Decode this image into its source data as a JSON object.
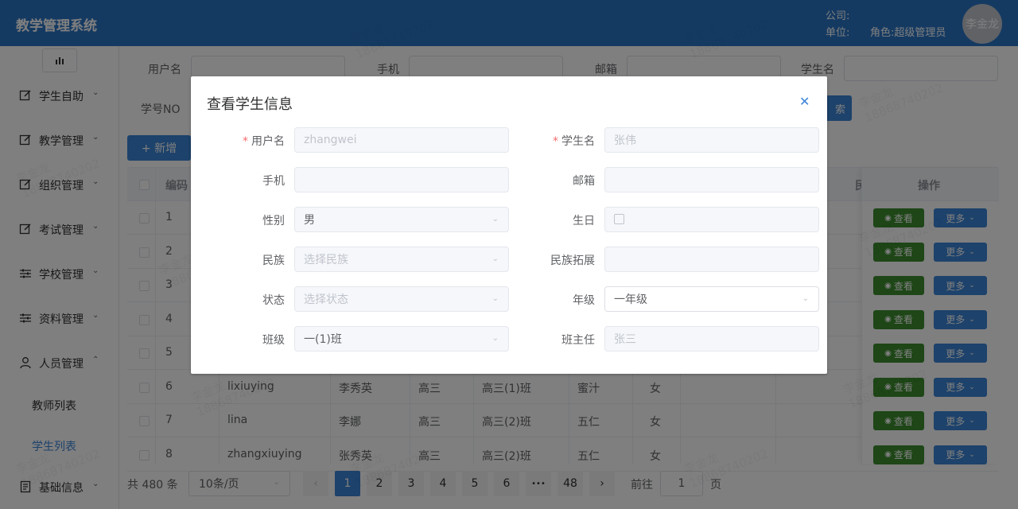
{
  "header": {
    "brand": "教学管理系统",
    "company_label": "公司:",
    "unit_label": "单位:",
    "role_label": "角色:超级管理员",
    "avatar_text": "李金龙"
  },
  "sidebar": {
    "items": [
      {
        "label": "学生自助",
        "icon": "edit-icon"
      },
      {
        "label": "教学管理",
        "icon": "edit-icon"
      },
      {
        "label": "组织管理",
        "icon": "edit-icon"
      },
      {
        "label": "考试管理",
        "icon": "edit-icon"
      },
      {
        "label": "学校管理",
        "icon": "sliders-icon"
      },
      {
        "label": "资料管理",
        "icon": "sliders-icon"
      },
      {
        "label": "人员管理",
        "icon": "user-icon"
      },
      {
        "label": "基础信息",
        "icon": "document-icon"
      }
    ],
    "subitems": [
      "教师列表",
      "学生列表"
    ]
  },
  "search": {
    "username_label": "用户名",
    "phone_label": "手机",
    "email_label": "邮箱",
    "student_name_label": "学生名",
    "student_no_label": "学号NO",
    "search_button": "索",
    "new_button": "+ 新增"
  },
  "table": {
    "headers": {
      "id": "编码",
      "ops": "操作",
      "partial": "民"
    },
    "rows": [
      {
        "id": "1"
      },
      {
        "id": "2"
      },
      {
        "id": "3"
      },
      {
        "id": "4"
      },
      {
        "id": "5"
      },
      {
        "id": "6",
        "username": "lixiuying",
        "name": "李秀英",
        "grade": "高三",
        "class": "高三(1)班",
        "ethnic": "蜜汁",
        "gender": "女"
      },
      {
        "id": "7",
        "username": "lina",
        "name": "李娜",
        "grade": "高三",
        "class": "高三(2)班",
        "ethnic": "五仁",
        "gender": "女"
      },
      {
        "id": "8",
        "username": "zhangxiuying",
        "name": "张秀英",
        "grade": "高三",
        "class": "高三(2)班",
        "ethnic": "五仁",
        "gender": "女"
      }
    ],
    "view_label": "查看",
    "more_label": "更多"
  },
  "pagination": {
    "total": "共 480 条",
    "page_size": "10条/页",
    "pages": [
      "1",
      "2",
      "3",
      "4",
      "5",
      "6",
      "•••",
      "48"
    ],
    "current": 1,
    "goto_label": "前往",
    "goto_value": "1",
    "page_suffix": "页"
  },
  "dialog": {
    "title": "查看学生信息",
    "fields": {
      "username": {
        "label": "用户名",
        "value": "zhangwei",
        "required": true
      },
      "student_name": {
        "label": "学生名",
        "value": "张伟",
        "required": true
      },
      "phone": {
        "label": "手机",
        "value": ""
      },
      "email": {
        "label": "邮箱",
        "value": ""
      },
      "gender": {
        "label": "性别",
        "value": "男"
      },
      "birthday": {
        "label": "生日",
        "value": ""
      },
      "ethnicity": {
        "label": "民族",
        "placeholder": "选择民族"
      },
      "ethnicity_ext": {
        "label": "民族拓展",
        "value": ""
      },
      "status": {
        "label": "状态",
        "placeholder": "选择状态"
      },
      "grade": {
        "label": "年级",
        "value": "一年级"
      },
      "class": {
        "label": "班级",
        "value": "一(1)班"
      },
      "head_teacher": {
        "label": "班主任",
        "value": "张三"
      }
    }
  },
  "watermark": {
    "name": "李金龙",
    "phone": "18868740202"
  }
}
